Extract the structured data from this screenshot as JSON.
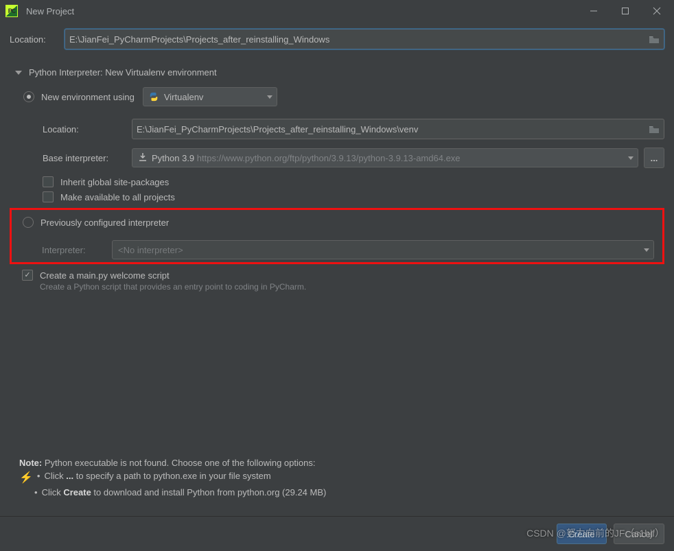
{
  "window": {
    "title": "New Project"
  },
  "location": {
    "label": "Location:",
    "value": "E:\\JianFei_PyCharmProjects\\Projects_after_reinstalling_Windows"
  },
  "interpreter_section": {
    "header": "Python Interpreter: New Virtualenv environment",
    "new_env": {
      "radio_label": "New environment using",
      "env_type": "Virtualenv",
      "location_label": "Location:",
      "location_value": "E:\\JianFei_PyCharmProjects\\Projects_after_reinstalling_Windows\\venv",
      "base_label": "Base interpreter:",
      "base_value": "Python 3.9",
      "base_hint": "https://www.python.org/ftp/python/3.9.13/python-3.9.13-amd64.exe",
      "inherit_label": "Inherit global site-packages",
      "make_available_label": "Make available to all projects"
    },
    "previous": {
      "radio_label": "Previously configured interpreter",
      "interpreter_label": "Interpreter:",
      "interpreter_value": "<No interpreter>"
    }
  },
  "welcome": {
    "checkbox_label": "Create a main.py welcome script",
    "description": "Create a Python script that provides an entry point to coding in PyCharm."
  },
  "note": {
    "prefix": "Note:",
    "text": "Python executable is not found. Choose one of the following options:",
    "line1_a": "Click ",
    "line1_b": "...",
    "line1_c": " to specify a path to python.exe in your file system",
    "line2_a": "Click ",
    "line2_b": "Create",
    "line2_c": " to download and install Python from python.org (29.24 MB)"
  },
  "footer": {
    "create": "Create",
    "cancel": "Cancel"
  },
  "watermark": "CSDN @努力向前的JF（s1hjf）"
}
